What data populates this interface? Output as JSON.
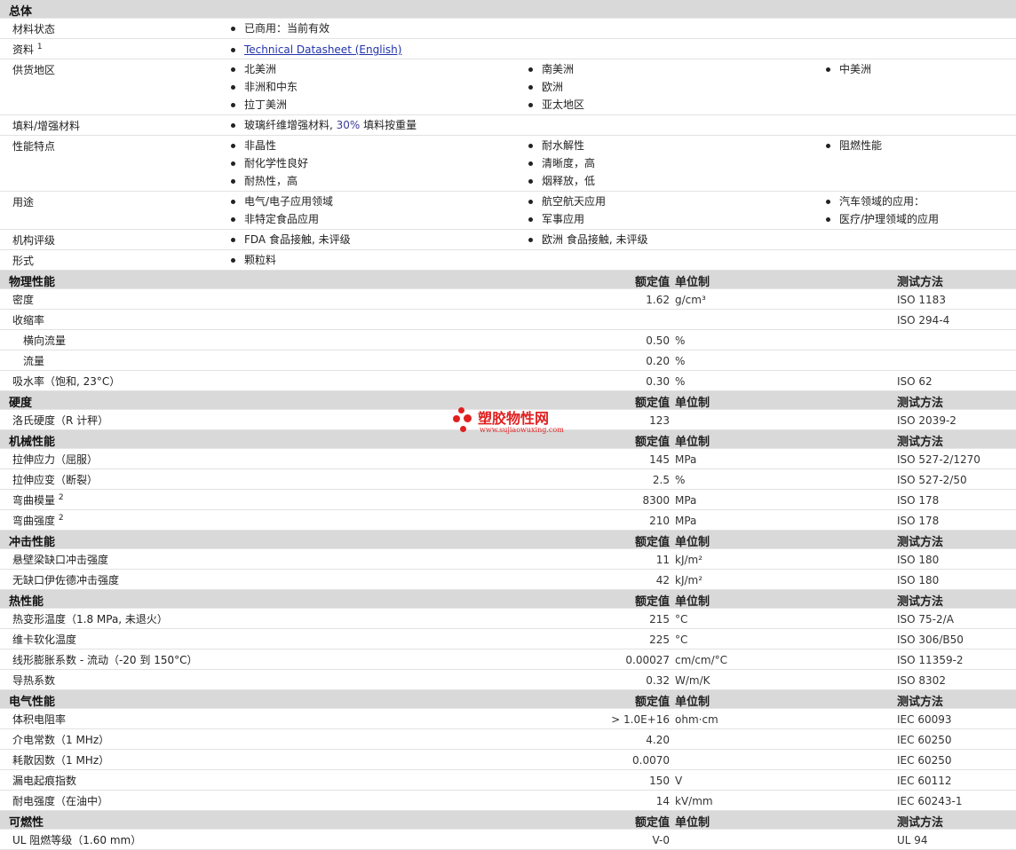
{
  "general": {
    "title": "总体",
    "material_status": {
      "label": "材料状态",
      "items": [
        "已商用：当前有效"
      ]
    },
    "documents": {
      "label": "资料",
      "sup": "1",
      "link": "Technical Datasheet (English)"
    },
    "availability": {
      "label": "供货地区",
      "items": [
        "北美洲",
        "南美洲",
        "中美洲",
        "非洲和中东",
        "欧洲",
        "拉丁美洲",
        "亚太地区"
      ]
    },
    "filler": {
      "label": "填料/增强材料",
      "text_a": "玻璃纤维增强材料, ",
      "text_num": "30%",
      "text_b": " 填料按重量"
    },
    "features": {
      "label": "性能特点",
      "items": [
        "非晶性",
        "耐水解性",
        "阻燃性能",
        "耐化学性良好",
        "清晰度，高",
        "耐热性，高",
        "烟释放，低"
      ]
    },
    "uses": {
      "label": "用途",
      "items": [
        "电气/电子应用领域",
        "航空航天应用",
        "汽车领域的应用：",
        "非特定食品应用",
        "军事应用",
        "医疗/护理领域的应用"
      ]
    },
    "agency": {
      "label": "机构评级",
      "items": [
        "FDA 食品接触, 未评级",
        "欧洲 食品接触, 未评级"
      ]
    },
    "forms": {
      "label": "形式",
      "items": [
        "颗粒料"
      ]
    }
  },
  "headers": {
    "value": "额定值",
    "unit": "单位制",
    "method": "测试方法"
  },
  "sections": [
    {
      "title": "物理性能",
      "rows": [
        {
          "label": "密度",
          "value": "1.62",
          "unit": "g/cm³",
          "method": "ISO 1183"
        },
        {
          "label": "收缩率",
          "value": "",
          "unit": "",
          "method": "ISO 294-4"
        },
        {
          "label": "横向流量",
          "value": "0.50",
          "unit": "%",
          "method": "",
          "sub": true
        },
        {
          "label": "流量",
          "value": "0.20",
          "unit": "%",
          "method": "",
          "sub": true
        },
        {
          "label": "吸水率（饱和, 23°C）",
          "value": "0.30",
          "unit": "%",
          "method": "ISO 62"
        }
      ]
    },
    {
      "title": "硬度",
      "rows": [
        {
          "label": "洛氏硬度（R 计秤）",
          "value": "123",
          "unit": "",
          "method": "ISO 2039-2"
        }
      ]
    },
    {
      "title": "机械性能",
      "rows": [
        {
          "label": "拉伸应力（屈服）",
          "value": "145",
          "unit": "MPa",
          "method": "ISO 527-2/1270"
        },
        {
          "label": "拉伸应变（断裂）",
          "value": "2.5",
          "unit": "%",
          "method": "ISO 527-2/50"
        },
        {
          "label": "弯曲模量",
          "sup": "2",
          "value": "8300",
          "unit": "MPa",
          "method": "ISO 178"
        },
        {
          "label": "弯曲强度",
          "sup": "2",
          "value": "210",
          "unit": "MPa",
          "method": "ISO 178"
        }
      ]
    },
    {
      "title": "冲击性能",
      "rows": [
        {
          "label": "悬壁梁缺口冲击强度",
          "value": "11",
          "unit": "kJ/m²",
          "method": "ISO 180"
        },
        {
          "label": "无缺口伊佐德冲击强度",
          "value": "42",
          "unit": "kJ/m²",
          "method": "ISO 180"
        }
      ]
    },
    {
      "title": "热性能",
      "rows": [
        {
          "label": "热变形温度（1.8 MPa, 未退火）",
          "value": "215",
          "unit": "°C",
          "method": "ISO 75-2/A"
        },
        {
          "label": "维卡软化温度",
          "value": "225",
          "unit": "°C",
          "method": "ISO 306/B50"
        },
        {
          "label": "线形膨胀系数 - 流动（-20 到  150°C）",
          "value": "0.00027",
          "unit": "cm/cm/°C",
          "method": "ISO 11359-2"
        },
        {
          "label": "导热系数",
          "value": "0.32",
          "unit": "W/m/K",
          "method": "ISO 8302"
        }
      ]
    },
    {
      "title": "电气性能",
      "rows": [
        {
          "label": "体积电阻率",
          "value": "> 1.0E+16",
          "unit": "ohm·cm",
          "method": "IEC 60093"
        },
        {
          "label": "介电常数（1 MHz）",
          "value": "4.20",
          "unit": "",
          "method": "IEC 60250"
        },
        {
          "label": "耗散因数（1 MHz）",
          "value": "0.0070",
          "unit": "",
          "method": "IEC 60250"
        },
        {
          "label": "漏电起痕指数",
          "value": "150",
          "unit": "V",
          "method": "IEC 60112"
        },
        {
          "label": "耐电强度（在油中）",
          "value": "14",
          "unit": "kV/mm",
          "method": "IEC 60243-1"
        }
      ]
    },
    {
      "title": "可燃性",
      "rows": [
        {
          "label": "UL 阻燃等级（1.60 mm）",
          "value": "V-0",
          "unit": "",
          "method": "UL 94"
        }
      ]
    }
  ],
  "watermark": {
    "name": "塑胶物性网",
    "url": "www.sujiaowuxing.com"
  },
  "colors": {
    "header_bg": "#d9d9d9",
    "link": "#2233aa",
    "watermark": "#e02020"
  }
}
